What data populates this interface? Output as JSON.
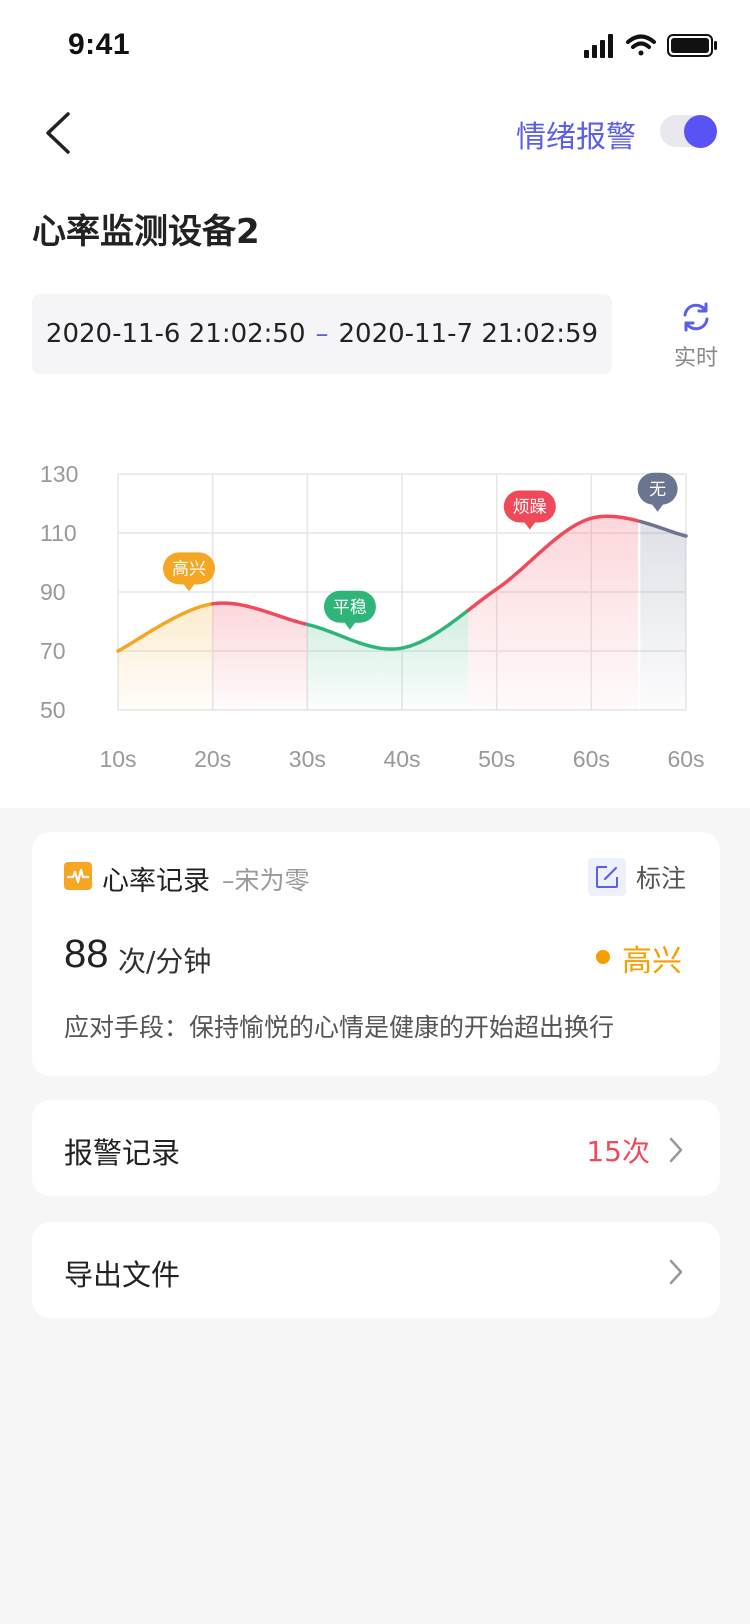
{
  "status_bar": {
    "time": "9:41"
  },
  "nav": {
    "alarm_label": "情绪报警",
    "alarm_enabled": true
  },
  "device": {
    "title": "心率监测设备2"
  },
  "range": {
    "start": "2020-11-6 21:02:50",
    "separator": "–",
    "end": "2020-11-7 21:02:59"
  },
  "realtime": {
    "label": "实时"
  },
  "chart_data": {
    "type": "line",
    "x_ticks": [
      "10s",
      "20s",
      "30s",
      "40s",
      "50s",
      "60s",
      "60s"
    ],
    "y_ticks": [
      "130",
      "110",
      "90",
      "70",
      "50"
    ],
    "ylim": [
      50,
      130
    ],
    "x": [
      10,
      20,
      30,
      40,
      50,
      60,
      70
    ],
    "y": [
      70,
      86,
      79,
      71,
      91,
      115,
      109
    ],
    "segments": [
      {
        "name": "高兴",
        "color": "#f5a623",
        "x": [
          10,
          20
        ]
      },
      {
        "name": "",
        "color": "#f04a5a",
        "x": [
          20,
          30
        ]
      },
      {
        "name": "平稳",
        "color": "#2fb57a",
        "x": [
          30,
          47
        ]
      },
      {
        "name": "烦躁",
        "color": "#f04a5a",
        "x": [
          47,
          65
        ]
      },
      {
        "name": "无",
        "color": "#6b7590",
        "x": [
          65,
          70
        ]
      }
    ],
    "mood_labels": [
      {
        "text": "高兴",
        "x": 17.5,
        "y": 98,
        "color": "#f5a623"
      },
      {
        "text": "平稳",
        "x": 34.5,
        "y": 85,
        "color": "#2fb57a"
      },
      {
        "text": "烦躁",
        "x": 53.5,
        "y": 119,
        "color": "#f04a5a"
      },
      {
        "text": "无",
        "x": 67,
        "y": 125,
        "color": "#6b7590"
      }
    ],
    "grid": true
  },
  "record": {
    "title": "心率记录",
    "user": "–宋为零",
    "mark_label": "标注",
    "bpm": "88",
    "unit": "次/分钟",
    "mood": "高兴",
    "mood_color": "#f5a000",
    "advice": "应对手段：保持愉悦的心情是健康的开始超出换行"
  },
  "alarm_record": {
    "label": "报警记录",
    "count": "15次"
  },
  "export": {
    "label": "导出文件"
  }
}
